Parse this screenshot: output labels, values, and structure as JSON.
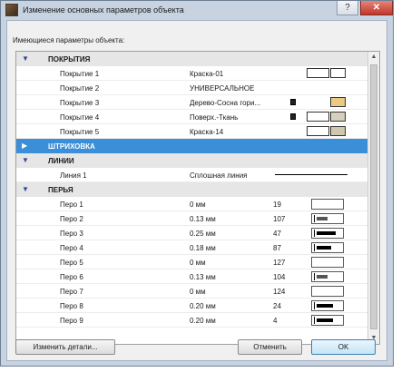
{
  "window": {
    "title": "Изменение основных параметров объекта"
  },
  "titlebar": {
    "help": "?",
    "close": "✕"
  },
  "caption": "Имеющиеся параметры объекта:",
  "sections": {
    "coverings": "ПОКРЫТИЯ",
    "hatching": "ШТРИХОВКА",
    "lines": "ЛИНИИ",
    "pens": "ПЕРЬЯ"
  },
  "coverings": [
    {
      "name": "Покрытие 1",
      "value": "Краска-01",
      "color1": "#ffffff",
      "color2": "#ffffff"
    },
    {
      "name": "Покрытие 2",
      "value": "УНИВЕРСАЛЬНОЕ"
    },
    {
      "name": "Покрытие 3",
      "value": "Дерево-Сосна гори...",
      "color1": "#ecc984"
    },
    {
      "name": "Покрытие 4",
      "value": "Поверх.-Ткань",
      "color1": "#ffffff",
      "color2": "#d6cfbd"
    },
    {
      "name": "Покрытие 5",
      "value": "Краска-14",
      "color1": "#ffffff",
      "color2": "#cfc7ae"
    }
  ],
  "lines": [
    {
      "name": "Линия 1",
      "value": "Сплошная линия"
    }
  ],
  "pens": [
    {
      "name": "Перо 1",
      "weight": "0 мм",
      "num": "19",
      "fill": 0
    },
    {
      "name": "Перо 2",
      "weight": "0.13 мм",
      "num": "107",
      "fill": 0.45
    },
    {
      "name": "Перо 3",
      "weight": "0.25 мм",
      "num": "47",
      "fill": 0.8
    },
    {
      "name": "Перо 4",
      "weight": "0.18 мм",
      "num": "87",
      "fill": 0.6
    },
    {
      "name": "Перо 5",
      "weight": "0 мм",
      "num": "127",
      "fill": 0
    },
    {
      "name": "Перо 6",
      "weight": "0.13 мм",
      "num": "104",
      "fill": 0.45
    },
    {
      "name": "Перо 7",
      "weight": "0 мм",
      "num": "124",
      "fill": 0
    },
    {
      "name": "Перо 8",
      "weight": "0.20 мм",
      "num": "24",
      "fill": 0.7
    },
    {
      "name": "Перо 9",
      "weight": "0.20 мм",
      "num": "4",
      "fill": 0.7
    }
  ],
  "buttons": {
    "edit": "Изменить детали...",
    "cancel": "Отменить",
    "ok": "OK"
  }
}
